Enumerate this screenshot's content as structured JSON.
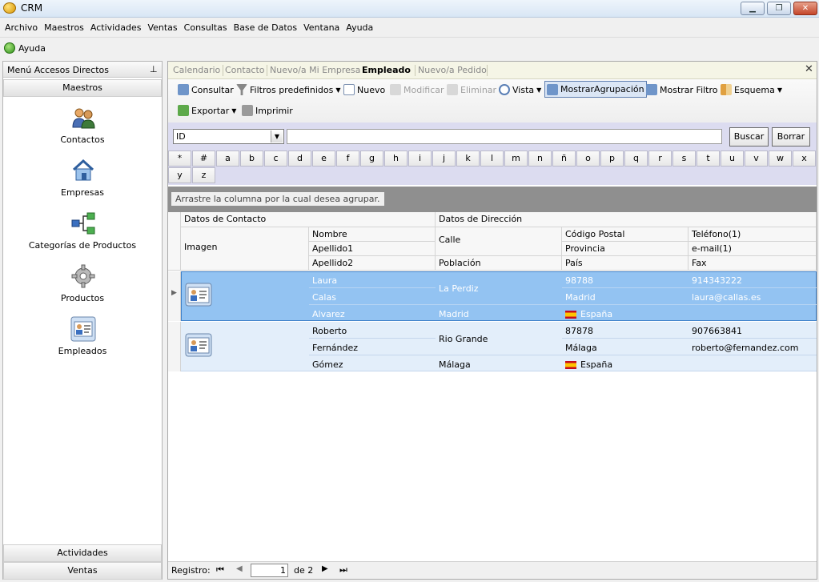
{
  "app": {
    "title": "CRM"
  },
  "window_buttons": {
    "minimize": "▁",
    "maximize": "❐",
    "close": "✕"
  },
  "menu": [
    "Archivo",
    "Maestros",
    "Actividades",
    "Ventas",
    "Consultas",
    "Base de Datos",
    "Ventana",
    "Ayuda"
  ],
  "help_bar": {
    "label": "Ayuda"
  },
  "sidebar": {
    "title": "Menú Accesos Directos",
    "pin": "⊥",
    "section_top": "Maestros",
    "items": [
      {
        "label": "Contactos",
        "icon": "contacts-icon"
      },
      {
        "label": "Empresas",
        "icon": "house-icon"
      },
      {
        "label": "Categorías de Productos",
        "icon": "hierarchy-icon"
      },
      {
        "label": "Productos",
        "icon": "gear-icon"
      },
      {
        "label": "Empleados",
        "icon": "employee-card-icon"
      }
    ],
    "section_bottom_1": "Actividades",
    "section_bottom_2": "Ventas"
  },
  "tabs": [
    {
      "label": "Calendario",
      "active": false
    },
    {
      "label": "Contacto",
      "active": false
    },
    {
      "label": "Nuevo/a Mi Empresa",
      "active": false
    },
    {
      "label": "Empleado",
      "active": true
    },
    {
      "label": "Nuevo/a Pedido",
      "active": false
    }
  ],
  "tab_close": "✕",
  "toolbar": {
    "consultar": "Consultar",
    "filtros": "Filtros predefinidos",
    "nuevo": "Nuevo",
    "modificar": "Modificar",
    "eliminar": "Eliminar",
    "vista": "Vista",
    "mostrar_agrupacion": "MostrarAgrupación",
    "mostrar_filtro": "Mostrar Filtro",
    "esquema": "Esquema",
    "exportar": "Exportar",
    "imprimir": "Imprimir"
  },
  "search": {
    "field": "ID",
    "value": "",
    "buscar": "Buscar",
    "borrar": "Borrar"
  },
  "alphabet": [
    "*",
    "#",
    "a",
    "b",
    "c",
    "d",
    "e",
    "f",
    "g",
    "h",
    "i",
    "j",
    "k",
    "l",
    "m",
    "n",
    "ñ",
    "o",
    "p",
    "q",
    "r",
    "s",
    "t",
    "u",
    "v",
    "w",
    "x",
    "y",
    "z"
  ],
  "group_hint": "Arrastre la columna por la cual desea agrupar.",
  "grid": {
    "band_contact": "Datos de Contacto",
    "band_address": "Datos de Dirección",
    "col_imagen": "Imagen",
    "col_nombre": "Nombre",
    "col_apellido1": "Apellido1",
    "col_apellido2": "Apellido2",
    "col_calle": "Calle",
    "col_poblacion": "Población",
    "col_cp": "Código Postal",
    "col_provincia": "Provincia",
    "col_pais": "País",
    "col_telefono": "Teléfono(1)",
    "col_email": "e-mail(1)",
    "col_fax": "Fax",
    "rows": [
      {
        "nombre": "Laura",
        "apellido1": "Calas",
        "apellido2": "Alvarez",
        "calle": "La Perdiz",
        "poblacion": "Madrid",
        "cp": "98788",
        "provincia": "Madrid",
        "pais": "España",
        "telefono": "914343222",
        "email": "laura@callas.es",
        "fax": "",
        "selected": true
      },
      {
        "nombre": "Roberto",
        "apellido1": "Fernández",
        "apellido2": "Gómez",
        "calle": "Rio Grande",
        "poblacion": "Málaga",
        "cp": "87878",
        "provincia": "Málaga",
        "pais": "España",
        "telefono": "907663841",
        "email": "roberto@fernandez.com",
        "fax": "",
        "selected": false
      }
    ]
  },
  "pager": {
    "label": "Registro:",
    "current": "1",
    "of_label": "de 2"
  },
  "colors": {
    "selected_row": "#93c3f2",
    "alt_row": "#e3eefa",
    "search_bg": "#dcdcf0"
  }
}
